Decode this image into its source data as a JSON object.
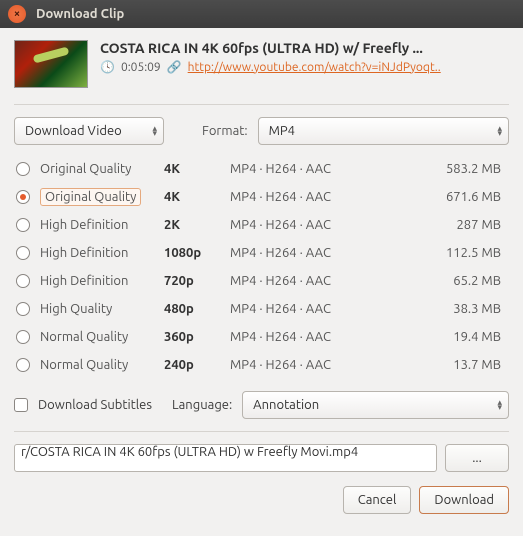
{
  "window": {
    "title": "Download Clip"
  },
  "video": {
    "title": "COSTA RICA IN 4K 60fps (ULTRA HD) w/ Freefly ...",
    "duration": "0:05:09",
    "url": "http://www.youtube.com/watch?v=iNJdPyoqt.."
  },
  "controls": {
    "download_mode": "Download Video",
    "format_label": "Format:",
    "format_value": "MP4"
  },
  "options": [
    {
      "quality": "Original Quality",
      "res": "4K",
      "codec": "MP4 · H264 · AAC",
      "size": "583.2 MB",
      "selected": false
    },
    {
      "quality": "Original Quality",
      "res": "4K",
      "codec": "MP4 · H264 · AAC",
      "size": "671.6 MB",
      "selected": true
    },
    {
      "quality": "High Definition",
      "res": "2K",
      "codec": "MP4 · H264 · AAC",
      "size": "287 MB",
      "selected": false
    },
    {
      "quality": "High Definition",
      "res": "1080p",
      "codec": "MP4 · H264 · AAC",
      "size": "112.5 MB",
      "selected": false
    },
    {
      "quality": "High Definition",
      "res": "720p",
      "codec": "MP4 · H264 · AAC",
      "size": "65.2 MB",
      "selected": false
    },
    {
      "quality": "High Quality",
      "res": "480p",
      "codec": "MP4 · H264 · AAC",
      "size": "38.3 MB",
      "selected": false
    },
    {
      "quality": "Normal Quality",
      "res": "360p",
      "codec": "MP4 · H264 · AAC",
      "size": "19.4 MB",
      "selected": false
    },
    {
      "quality": "Normal Quality",
      "res": "240p",
      "codec": "MP4 · H264 · AAC",
      "size": "13.7 MB",
      "selected": false
    }
  ],
  "subtitles": {
    "checkbox_label": "Download Subtitles",
    "language_label": "Language:",
    "language_value": "Annotation"
  },
  "output": {
    "path": "r/COSTA RICA IN 4K 60fps (ULTRA HD) w  Freefly Movi.mp4",
    "browse": "..."
  },
  "buttons": {
    "cancel": "Cancel",
    "download": "Download"
  }
}
